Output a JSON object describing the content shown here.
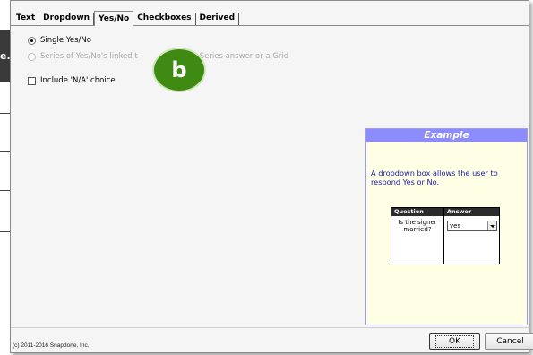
{
  "background": {
    "fragment_text": "e."
  },
  "tabs": [
    {
      "label": "Text",
      "active": false
    },
    {
      "label": "Dropdown",
      "active": false
    },
    {
      "label": "Yes/No",
      "active": true
    },
    {
      "label": "Checkboxes",
      "active": false
    },
    {
      "label": "Derived",
      "active": false
    }
  ],
  "options": {
    "single_label": "Single Yes/No",
    "series_label_left": "Series of Yes/No's linked t",
    "series_label_right": "Series answer or a Grid",
    "include_na_label": "Include 'N/A' choice"
  },
  "callout": {
    "letter": "b",
    "color": "#3f8a13"
  },
  "example": {
    "title": "Example",
    "description": "A dropdown box allows the user to respond Yes or No.",
    "table": {
      "question_header": "Question",
      "answer_header": "Answer",
      "question_text": "Is the signer married?",
      "answer_value": "yes"
    }
  },
  "footer": {
    "copyright": "(c) 2011-2016 Snapdone, Inc.",
    "ok_label": "OK",
    "cancel_label": "Cancel"
  },
  "colors": {
    "example_header": "#8c8cff",
    "example_bg": "#ffffe6",
    "example_text": "#1a1aa8"
  }
}
